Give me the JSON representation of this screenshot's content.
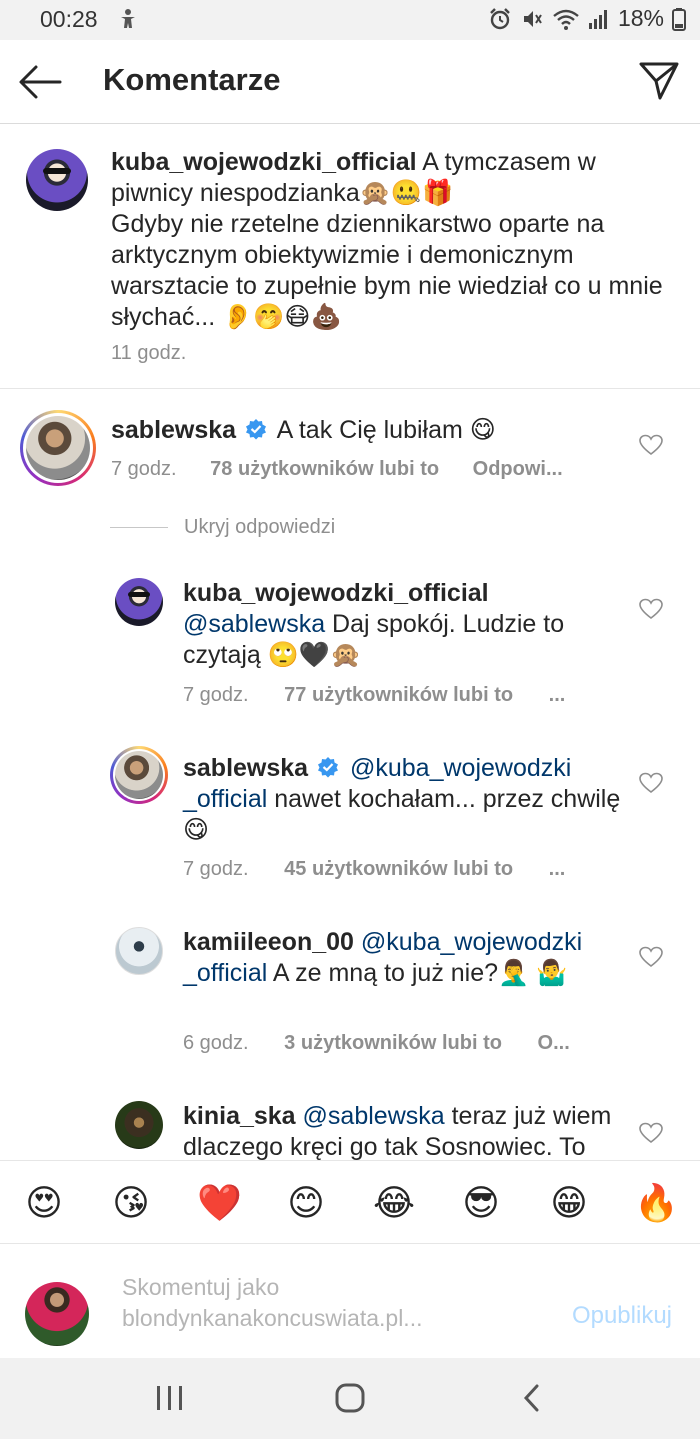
{
  "status_bar": {
    "time": "00:28",
    "battery": "18%"
  },
  "header": {
    "title": "Komentarze"
  },
  "caption": {
    "username": "kuba_wojewodzki_official",
    "text_1": " A tymczasem w piwnicy niespodzianka🙊🤐🎁",
    "text_2": "Gdyby nie rzetelne dziennikarstwo oparte na arktycznym obiektywizmie i demonicznym warsztacie to zupełnie bym nie wiedział co u mnie słychać... 👂🤭😷💩",
    "time": "11 godz."
  },
  "comments": [
    {
      "username": "sablewska",
      "text": "A tak Cię lubiłam 😋",
      "time": "7 godz.",
      "likes": "78 użytkowników lubi to",
      "reply": "Odpowi..."
    }
  ],
  "hide_replies": "Ukryj odpowiedzi",
  "replies": [
    {
      "username": "kuba_wojewodzki_official",
      "mention": "@sablewska",
      "text": " Daj spokój. Ludzie to czytają 🙄🖤🙊",
      "time": "7 godz.",
      "likes": "77 użytkowników lubi to",
      "more": "..."
    },
    {
      "username": "sablewska",
      "mention": "@kuba_wojewodzki _official",
      "text": " nawet kochałam... przez chwilę 😋",
      "time": "7 godz.",
      "likes": "45 użytkowników lubi to",
      "more": "..."
    },
    {
      "username": "kamiileeon_00",
      "mention": "@kuba_wojewodzki _official",
      "text": " A ze mną to już nie?🤦‍♂️ 🤷‍♂️",
      "time": "6 godz.",
      "likes": "3 użytkowników lubi to",
      "more": "O..."
    },
    {
      "username": "kinia_ska",
      "mention": "@sablewska",
      "text": " teraz już wiem dlaczego kręci go tak Sosnowiec.  To"
    }
  ],
  "emoji_bar": [
    "😍",
    "😘",
    "❤️",
    "😊",
    "😂",
    "😎",
    "😁",
    "🔥"
  ],
  "composer": {
    "placeholder": "Skomentuj jako\nblondynkanakoncuswiata.pl...",
    "publish": "Opublikuj"
  },
  "colors": {
    "link": "#00376b",
    "publish_disabled": "#b3dbff",
    "verified": "#3897f0"
  }
}
